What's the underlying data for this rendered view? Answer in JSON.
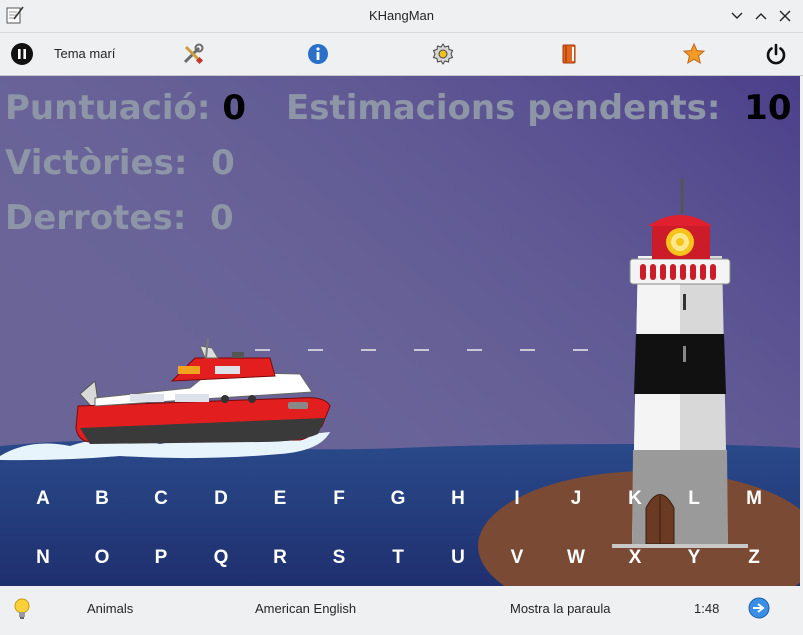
{
  "window": {
    "title": "KHangMan"
  },
  "toolbar": {
    "category_label": "Tema marí"
  },
  "icons": [
    "pause-icon",
    "tools-icon",
    "info-icon",
    "settings-icon",
    "book-icon",
    "star-icon",
    "power-icon",
    "lightbulb-icon",
    "next-arrow-icon"
  ],
  "scores": {
    "score_label": "Puntuació:",
    "score_value": "0",
    "pending_label": "Estimacions pendents:",
    "pending_value": "10",
    "wins_label": "Victòries:",
    "wins_value": "0",
    "losses_label": "Derrotes:",
    "losses_value": "0"
  },
  "word": {
    "letter_count": 7
  },
  "keyboard": {
    "row1": [
      "A",
      "B",
      "C",
      "D",
      "E",
      "F",
      "G",
      "H",
      "I",
      "J",
      "K",
      "L",
      "M"
    ],
    "row2": [
      "N",
      "O",
      "P",
      "Q",
      "R",
      "S",
      "T",
      "U",
      "V",
      "W",
      "X",
      "Y",
      "Z"
    ]
  },
  "status": {
    "category": "Animals",
    "language": "American English",
    "show_word": "Mostra la paraula",
    "timer": "1:48"
  },
  "colors": {
    "sky_top": "#4a4488",
    "sky_bottom": "#8e86a6",
    "sea": "#2a3b7a",
    "island": "#7a4a35",
    "boat_red": "#e31e1e"
  }
}
